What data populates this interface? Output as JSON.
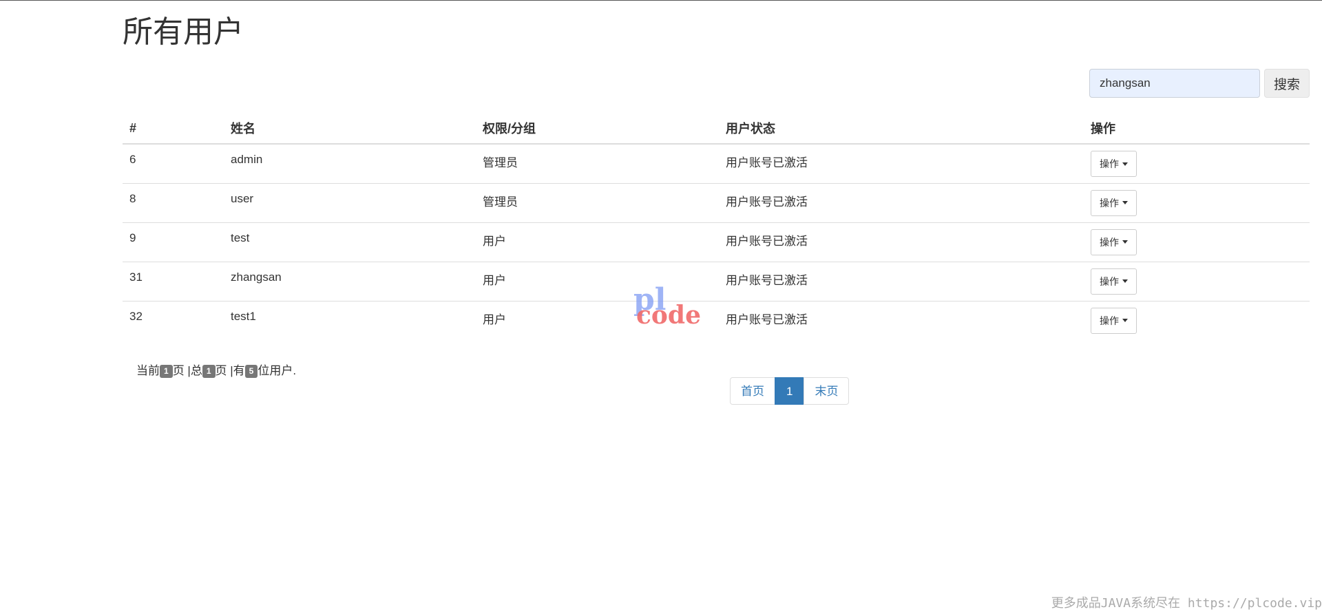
{
  "page": {
    "title": "所有用户"
  },
  "search": {
    "value": "zhangsan",
    "button_label": "搜索"
  },
  "table": {
    "headers": [
      "#",
      "姓名",
      "权限/分组",
      "用户状态",
      "操作"
    ],
    "rows": [
      {
        "id": "6",
        "name": "admin",
        "role": "管理员",
        "status": "用户账号已激活",
        "action": "操作"
      },
      {
        "id": "8",
        "name": "user",
        "role": "管理员",
        "status": "用户账号已激活",
        "action": "操作"
      },
      {
        "id": "9",
        "name": "test",
        "role": "用户",
        "status": "用户账号已激活",
        "action": "操作"
      },
      {
        "id": "31",
        "name": "zhangsan",
        "role": "用户",
        "status": "用户账号已激活",
        "action": "操作"
      },
      {
        "id": "32",
        "name": "test1",
        "role": "用户",
        "status": "用户账号已激活",
        "action": "操作"
      }
    ]
  },
  "summary": {
    "prefix": "当前",
    "current_page": "1",
    "text_page": "页 |总",
    "total_pages": "1",
    "text_have": "页 |有",
    "user_count": "5",
    "suffix": "位用户."
  },
  "pagination": {
    "first": "首页",
    "current": "1",
    "last": "末页"
  },
  "watermark": {
    "pl": "pl",
    "code": "code"
  },
  "footer_watermark": "更多成品JAVA系统尽在 https://plcode.vip",
  "colors": {
    "link": "#337ab7",
    "badge": "#777777",
    "search_bg": "#e8f0fe"
  }
}
